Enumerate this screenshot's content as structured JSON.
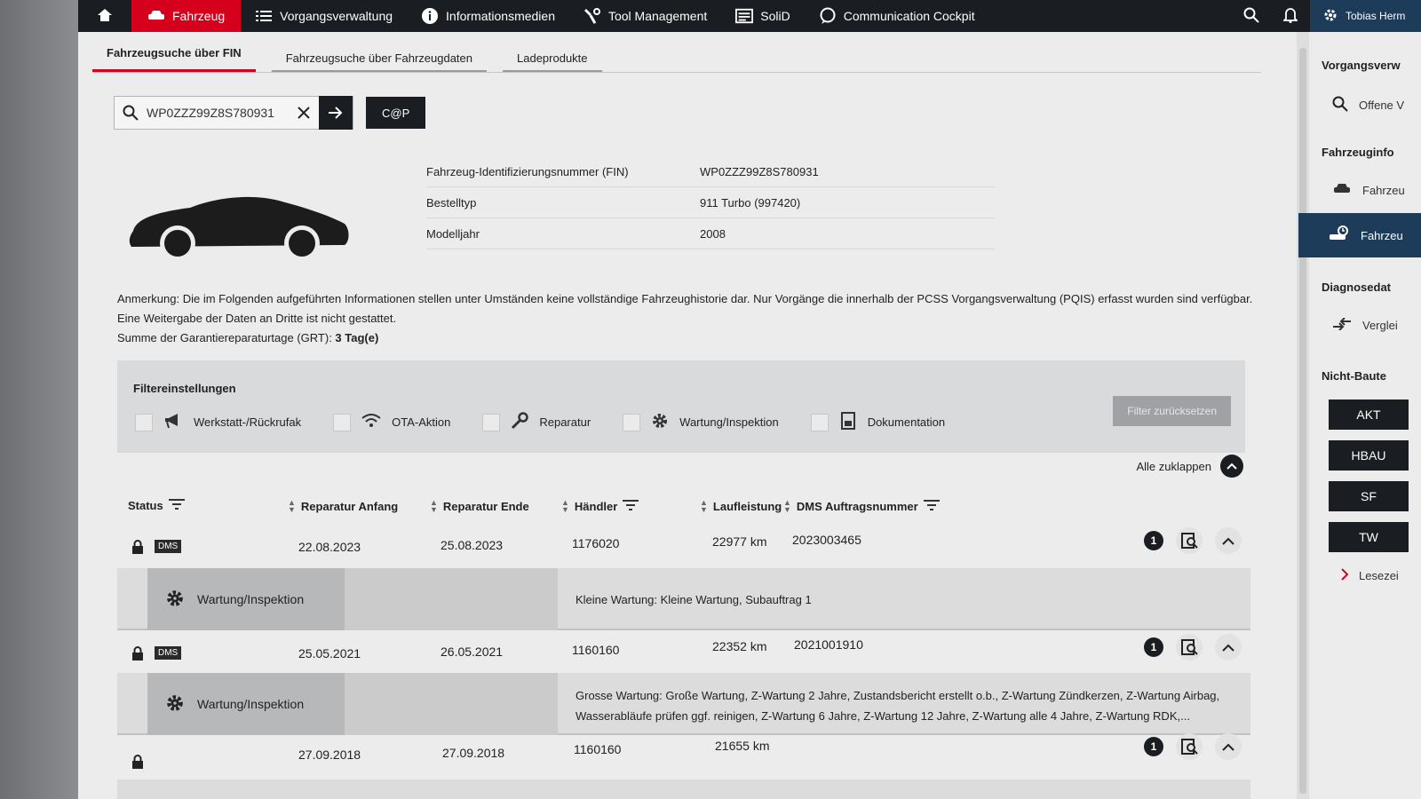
{
  "topbar": {
    "active_item": "Fahrzeug",
    "items": [
      "Vorgangsverwaltung",
      "Informationsmedien",
      "Tool Management",
      "SoliD",
      "Communication Cockpit"
    ],
    "user": "Tobias Herm"
  },
  "tabs": [
    "Fahrzeugsuche über FIN",
    "Fahrzeugsuche über Fahrzeugdaten",
    "Ladeprodukte"
  ],
  "search": {
    "value": "WP0ZZZ99Z8S780931",
    "cap_label": "C@P"
  },
  "vehicle": {
    "rows": [
      {
        "key": "Fahrzeug-Identifizierungsnummer (FIN)",
        "value": "WP0ZZZ99Z8S780931"
      },
      {
        "key": "Bestelltyp",
        "value": "911 Turbo (997420)"
      },
      {
        "key": "Modelljahr",
        "value": "2008"
      }
    ]
  },
  "notes": {
    "line1": "Anmerkung: Die im Folgenden aufgeführten Informationen stellen unter Umständen keine vollständige Fahrzeughistorie dar. Nur Vorgänge die innerhalb der PCSS Vorgangsverwaltung (PQIS) erfasst wurden sind verfügbar.",
    "line2": "Eine Weitergabe der Daten an Dritte ist nicht gestattet.",
    "line3_prefix": "Summe der Garantiereparaturtage (GRT): ",
    "line3_value": "3 Tag(e)"
  },
  "filters": {
    "title": "Filtereinstellungen",
    "items": [
      "Werkstatt-/Rückrufak",
      "OTA-Aktion",
      "Reparatur",
      "Wartung/Inspektion",
      "Dokumentation"
    ],
    "reset_label": "Filter zurücksetzen"
  },
  "collapse_all_label": "Alle zuklappen",
  "table": {
    "headers": {
      "status": "Status",
      "start": "Reparatur Anfang",
      "end": "Reparatur Ende",
      "dealer": "Händler",
      "mileage": "Laufleistung",
      "dms": "DMS Auftragsnummer"
    },
    "rows": [
      {
        "dms_tag": "DMS",
        "start": "22.08.2023",
        "end": "25.08.2023",
        "dealer": "1176020",
        "mileage": "22977 km",
        "dms_no": "2023003465",
        "badge": "1",
        "detail_type": "Wartung/Inspektion",
        "detail_desc": "Kleine Wartung: Kleine Wartung, Subauftrag 1"
      },
      {
        "dms_tag": "DMS",
        "start": "25.05.2021",
        "end": "26.05.2021",
        "dealer": "1160160",
        "mileage": "22352 km",
        "dms_no": "2021001910",
        "badge": "1",
        "detail_type": "Wartung/Inspektion",
        "detail_desc": "Grosse Wartung: Große Wartung, Z-Wartung 2 Jahre, Zustandsbericht erstellt o.b., Z-Wartung Zündkerzen, Z-Wartung Airbag, Wasserabläufe prüfen ggf. reinigen, Z-Wartung 6 Jahre, Z-Wartung 12 Jahre, Z-Wartung alle 4 Jahre, Z-Wartung RDK,..."
      },
      {
        "start": "27.09.2018",
        "end": "27.09.2018",
        "dealer": "1160160",
        "mileage": "21655 km",
        "badge": "1"
      }
    ]
  },
  "right_panel": {
    "vorgang_head": "Vorgangsverw",
    "vorgang_item": "Offene V",
    "fahrzeug_head": "Fahrzeuginfo",
    "fahrzeug_item1": "Fahrzeu",
    "fahrzeug_item2": "Fahrzeu",
    "diag_head": "Diagnosedat",
    "diag_item": "Verglei",
    "nicht_head": "Nicht-Baute",
    "buttons": [
      "AKT",
      "HBAU",
      "SF",
      "TW"
    ],
    "lese": "Lesezei"
  }
}
